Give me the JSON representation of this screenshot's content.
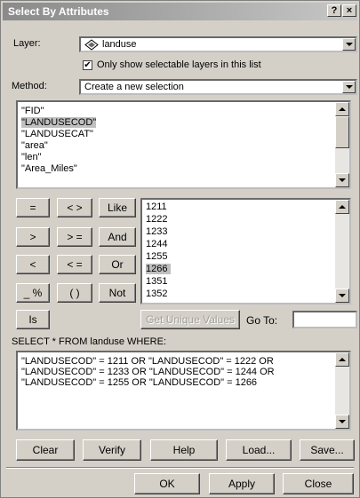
{
  "window": {
    "title": "Select By Attributes",
    "help_label": "?",
    "close_label": "×"
  },
  "layer": {
    "label": "Layer:",
    "value": "landuse",
    "checkbox_label": "Only show selectable layers in this list",
    "checked": true
  },
  "method": {
    "label": "Method:",
    "value": "Create a new selection"
  },
  "fields": [
    "\"FID\"",
    "\"LANDUSECOD\"",
    "\"LANDUSECAT\"",
    "\"area\"",
    "\"len\"",
    "\"Area_Miles\""
  ],
  "operators": {
    "eq": "=",
    "ne": "< >",
    "like": "Like",
    "gt": ">",
    "ge": "> =",
    "and": "And",
    "lt": "<",
    "le": "< =",
    "or": "Or",
    "pct": "_ %",
    "paren": "( )",
    "not": "Not",
    "is": "Is"
  },
  "values": [
    "1211",
    "1222",
    "1233",
    "1244",
    "1255",
    "1266",
    "1351",
    "1352"
  ],
  "unique_button": "Get Unique Values",
  "goto_label": "Go To:",
  "query_label": "SELECT * FROM landuse WHERE:",
  "query_lines": [
    "\"LANDUSECOD\" = 1211 OR \"LANDUSECOD\" = 1222 OR",
    "\"LANDUSECOD\" = 1233 OR \"LANDUSECOD\" = 1244 OR",
    "\"LANDUSECOD\" = 1255 OR \"LANDUSECOD\" = 1266"
  ],
  "actions": {
    "clear": "Clear",
    "verify": "Verify",
    "help": "Help",
    "load": "Load...",
    "save": "Save..."
  },
  "footer": {
    "ok": "OK",
    "apply": "Apply",
    "close": "Close"
  }
}
